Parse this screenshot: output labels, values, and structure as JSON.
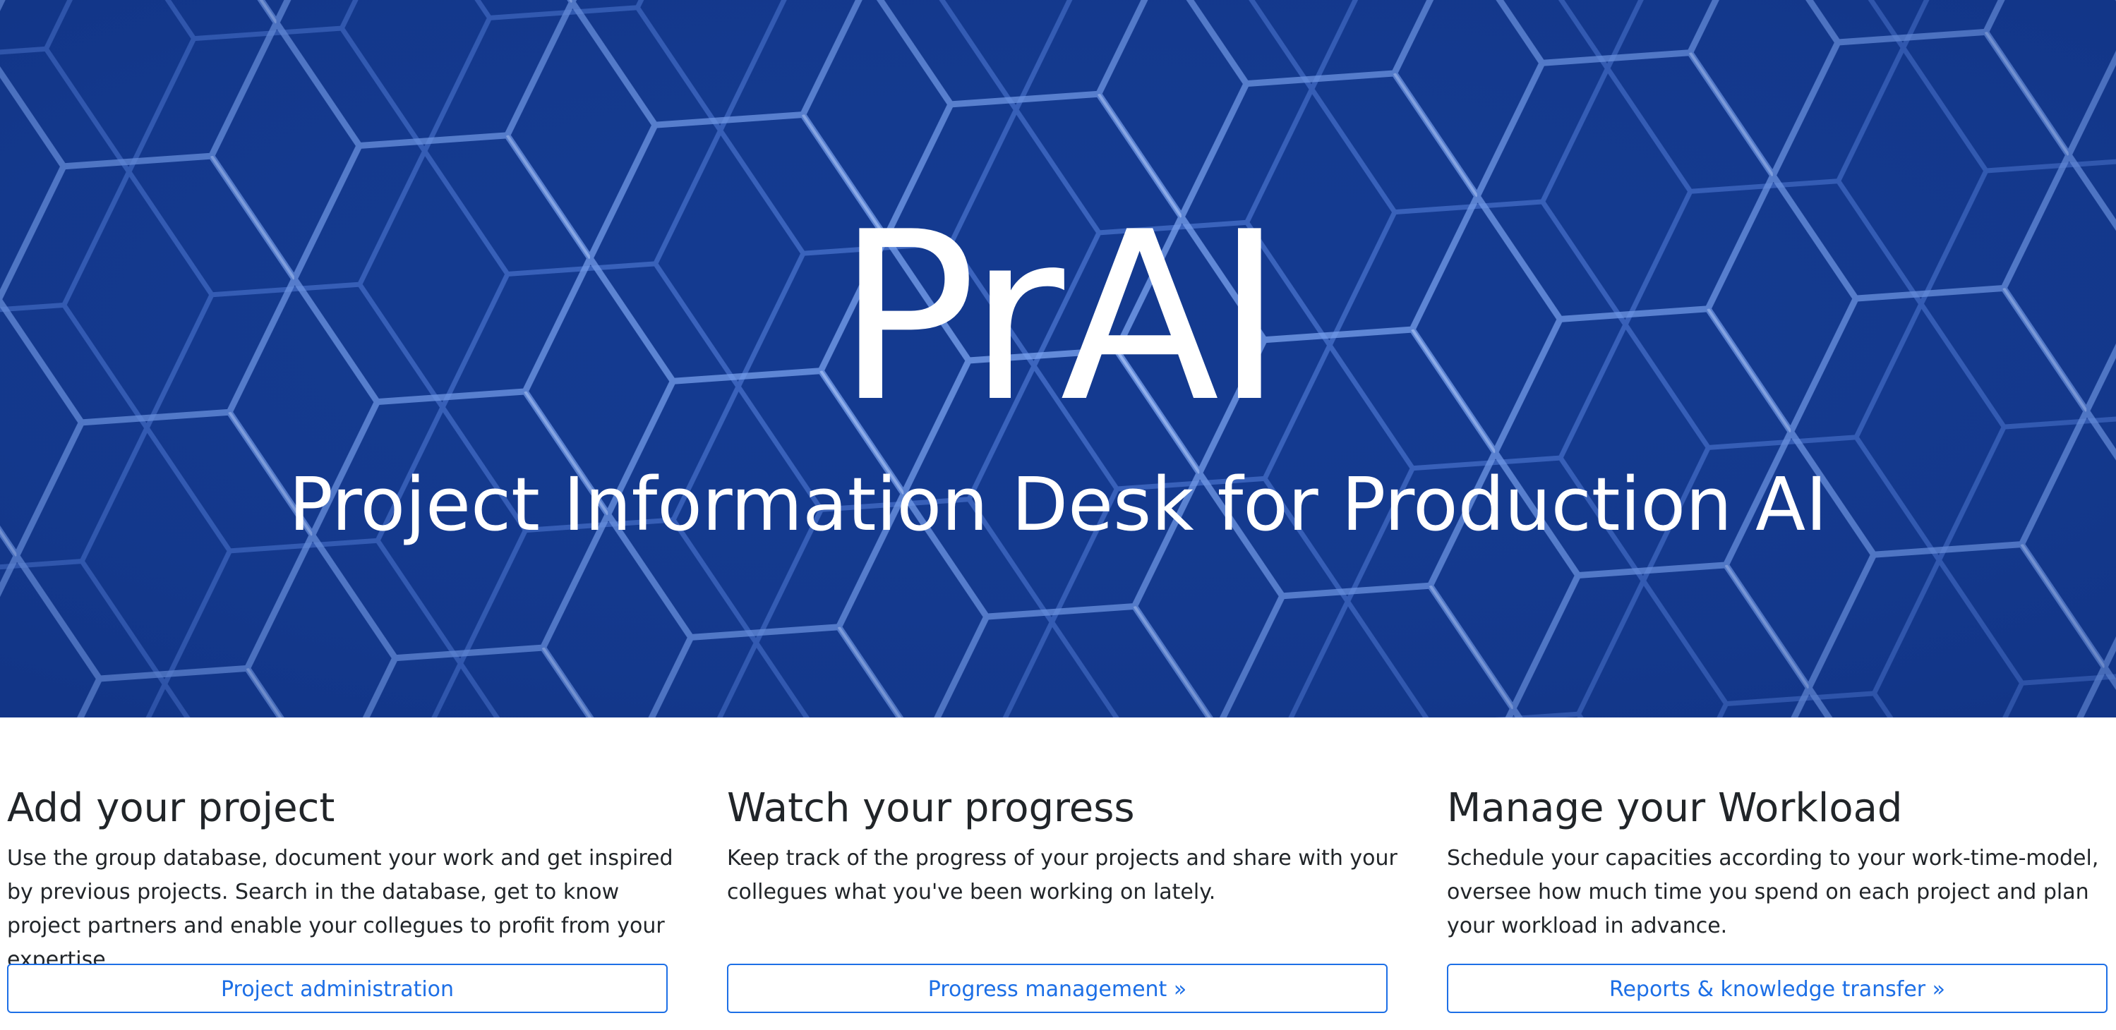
{
  "hero": {
    "title": "PrAI",
    "subtitle": "Project Information Desk for Production AI",
    "background_color": "#143a8f",
    "pattern_color": "#6f9bf0"
  },
  "features": [
    {
      "heading": "Add your project",
      "text": "Use the group database, document your work and get inspired by previous projects. Search in the database, get to know project partners and enable your collegues to profit from your expertise.",
      "button_label": "Project administration"
    },
    {
      "heading": "Watch your progress",
      "text": "Keep track of the progress of your projects and share with your collegues what you've been working on lately.",
      "button_label": "Progress management »"
    },
    {
      "heading": "Manage your Workload",
      "text": "Schedule your capacities according to your work-time-model, oversee how much time you spend on each project and plan your workload in advance.",
      "button_label": "Reports & knowledge transfer »"
    }
  ],
  "colors": {
    "accent": "#1d6fe6",
    "text": "#212529"
  }
}
